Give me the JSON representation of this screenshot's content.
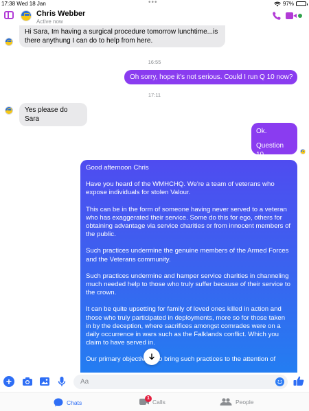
{
  "status_bar": {
    "time_date": "17:38  Wed 18 Jan",
    "battery": "97%",
    "battery_level": 0.97
  },
  "header": {
    "contact_name": "Chris Webber",
    "contact_status": "Active now"
  },
  "messages": [
    {
      "from": "contact",
      "text": "Hi Sara, Im having a surgical procedure tomorrow lunchtime...is there anythung I can do to help from here."
    },
    {
      "timestamp": "16:55"
    },
    {
      "from": "me",
      "text": "Oh sorry, hope it's not serious. Could I run Q 10 now?"
    },
    {
      "timestamp": "17:11"
    },
    {
      "from": "contact",
      "text": "Yes please do Sara"
    },
    {
      "from": "me",
      "text": "Ok."
    },
    {
      "from": "me",
      "text": "Question 10."
    }
  ],
  "long_message": {
    "paragraphs": [
      "Good afternoon Chris",
      "Have you heard of the WMHCHQ. We're a team of veterans who expose individuals for stolen Valour.",
      "This can be in the form of someone having never served to a veteran who has exaggerated their service. Some do this for ego, others for obtaining advantage via service charities or from innocent members of the public.",
      "Such practices undermine the genuine members of the Armed Forces and the Veterans community.",
      "Such practices undermine and hamper service charities in channeling much needed help to those who truly suffer because of their service to the crown.",
      "It can be quite upsetting for family of loved ones killed in action and those who truly participated in deployments, more so for those taken in by the deception, where sacrifices amongst comrades were on a daily occurrence in wars such as the Falklands conflict. Which you claim to have served in.",
      "Our primary objective is to bring such practices to the attention of"
    ]
  },
  "composer": {
    "placeholder": "Aa"
  },
  "tabs": [
    {
      "label": "Chats"
    },
    {
      "label": "Calls",
      "badge": "1"
    },
    {
      "label": "People"
    }
  ],
  "colors": {
    "accent": "#b23bd6",
    "outgoing_bubble": "#8a3cf0",
    "blue": "#2e6ef5"
  }
}
